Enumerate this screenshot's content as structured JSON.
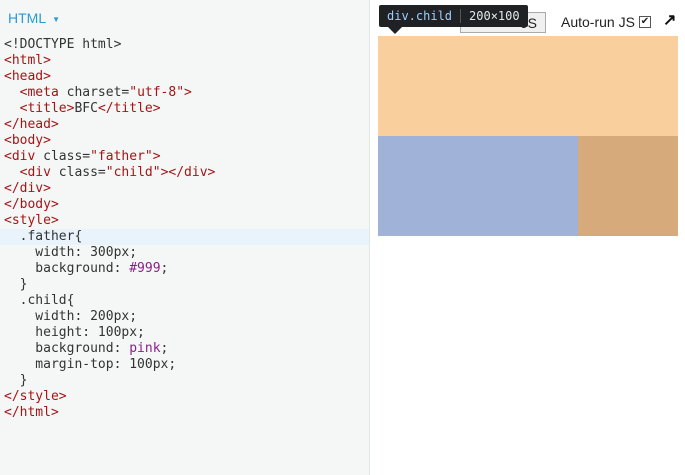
{
  "editor": {
    "language": "HTML",
    "code_lines": [
      [
        {
          "t": "plain",
          "v": "<!DOCTYPE html>"
        }
      ],
      [
        {
          "t": "tag",
          "v": "<html>"
        }
      ],
      [
        {
          "t": "tag",
          "v": "<head>"
        }
      ],
      [
        {
          "t": "plain",
          "v": "  "
        },
        {
          "t": "tag",
          "v": "<meta "
        },
        {
          "t": "plain",
          "v": "charset="
        },
        {
          "t": "str",
          "v": "\"utf-8\""
        },
        {
          "t": "tag",
          "v": ">"
        }
      ],
      [
        {
          "t": "plain",
          "v": "  "
        },
        {
          "t": "tag",
          "v": "<title>"
        },
        {
          "t": "plain",
          "v": "BFC"
        },
        {
          "t": "tag",
          "v": "</title>"
        }
      ],
      [
        {
          "t": "tag",
          "v": "</head>"
        }
      ],
      [
        {
          "t": "tag",
          "v": "<body>"
        }
      ],
      [
        {
          "t": "tag",
          "v": "<div "
        },
        {
          "t": "plain",
          "v": "class="
        },
        {
          "t": "str",
          "v": "\"father\""
        },
        {
          "t": "tag",
          "v": ">"
        }
      ],
      [
        {
          "t": "plain",
          "v": "  "
        },
        {
          "t": "tag",
          "v": "<div "
        },
        {
          "t": "plain",
          "v": "class="
        },
        {
          "t": "str",
          "v": "\"child\""
        },
        {
          "t": "tag",
          "v": "></div>"
        }
      ],
      [
        {
          "t": "tag",
          "v": "</div>"
        }
      ],
      [
        {
          "t": "tag",
          "v": "</body>"
        }
      ],
      [
        {
          "t": "tag",
          "v": "<style>"
        }
      ],
      [
        {
          "t": "plain",
          "v": "  .father{"
        }
      ],
      [
        {
          "t": "plain",
          "v": "    width: 300px;"
        }
      ],
      [
        {
          "t": "plain",
          "v": "    background: "
        },
        {
          "t": "val",
          "v": "#999"
        },
        {
          "t": "plain",
          "v": ";"
        }
      ],
      [
        {
          "t": "plain",
          "v": "  }"
        }
      ],
      [
        {
          "t": "plain",
          "v": "  .child{"
        }
      ],
      [
        {
          "t": "plain",
          "v": "    width: 200px;"
        }
      ],
      [
        {
          "t": "plain",
          "v": "    height: 100px;"
        }
      ],
      [
        {
          "t": "plain",
          "v": "    background: "
        },
        {
          "t": "val",
          "v": "pink"
        },
        {
          "t": "plain",
          "v": ";"
        }
      ],
      [
        {
          "t": "plain",
          "v": "    margin-top: 100px;"
        }
      ],
      [
        {
          "t": "plain",
          "v": "  }"
        }
      ],
      [
        {
          "t": "tag",
          "v": "</style>"
        }
      ],
      [
        {
          "t": "tag",
          "v": "</html>"
        }
      ]
    ],
    "highlighted_line": 12
  },
  "preview": {
    "run_label": "JS",
    "auto_run_label": "Auto-run JS",
    "auto_run_checked": "✔",
    "popout_icon": "↗"
  },
  "tooltip": {
    "element": "div.child",
    "dims": "200×100"
  },
  "colors": {
    "margin": "#f8cf9d",
    "content": "#a0b2d8",
    "margin_right": "#d6aa7a"
  }
}
